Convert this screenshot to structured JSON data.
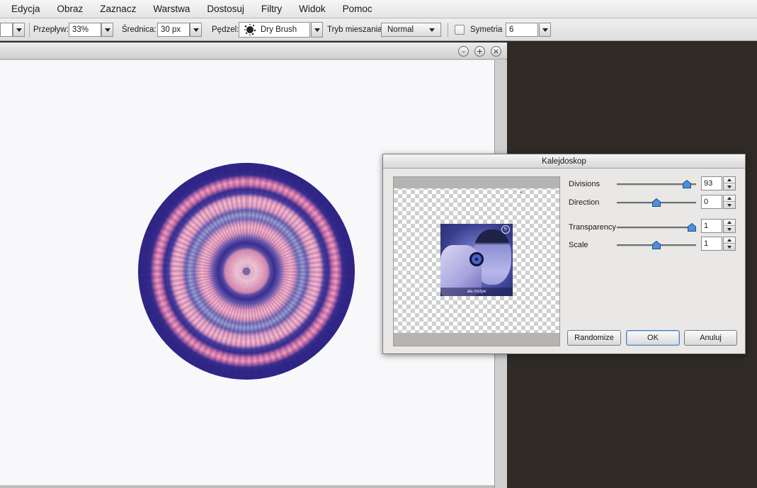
{
  "menu": [
    "Edycja",
    "Obraz",
    "Zaznacz",
    "Warstwa",
    "Dostosuj",
    "Filtry",
    "Widok",
    "Pomoc"
  ],
  "toolbar": {
    "flow_label": "Przepływ:",
    "flow_value": "33%",
    "diameter_label": "Średnica:",
    "diameter_value": "30 px",
    "brush_label": "Pędzel:",
    "brush_value": "Dry Brush",
    "blend_label": "Tryb mieszania:",
    "blend_value": "Normal",
    "symmetry_label": "Symetria",
    "symmetry_checked": false,
    "symmetry_value": "6"
  },
  "document": {
    "buttons": [
      "minimize-icon",
      "maximize-icon",
      "close-icon"
    ],
    "canvas_color": "#f8f8fa"
  },
  "dialog": {
    "title": "Kalejdoskop",
    "preview_caption": "ala motyw",
    "params": {
      "divisions": {
        "label": "Divisions",
        "value": "93",
        "level": 0.93
      },
      "direction": {
        "label": "Direction",
        "value": "0",
        "level": 0.5
      },
      "transparency": {
        "label": "Transparency",
        "value": "1",
        "level": 1.0
      },
      "scale": {
        "label": "Scale",
        "value": "1",
        "level": 0.5
      }
    },
    "buttons": {
      "randomize": "Randomize",
      "ok": "OK",
      "cancel": "Anuluj"
    }
  },
  "colors": {
    "accent_thumb": "#4a8fd8",
    "mandala_dark": "#2f2687",
    "mandala_pink": "#f3a8bf",
    "background_dark": "#2f2a26"
  }
}
